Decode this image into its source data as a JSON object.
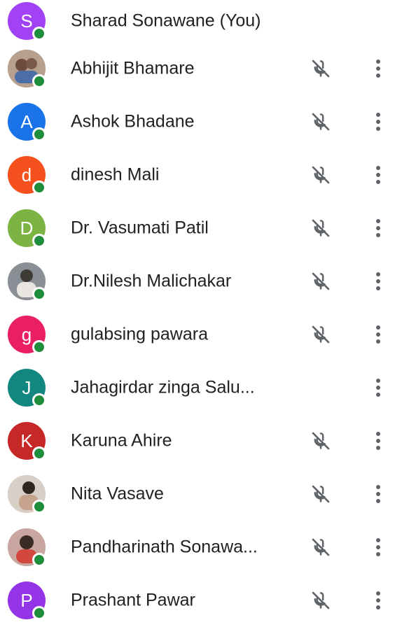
{
  "colors": {
    "online": "#1e8e3e",
    "text": "#202124",
    "icon": "#5f6368"
  },
  "participants": [
    {
      "name": "Sharad Sonawane (You)",
      "initial": "S",
      "avatar_color": "#a142f4",
      "photo": false,
      "muted_icon": false,
      "more_icon": false
    },
    {
      "name": "Abhijit Bhamare",
      "initial": "",
      "avatar_color": "#b7a08d",
      "photo": true,
      "muted_icon": true,
      "more_icon": true
    },
    {
      "name": "Ashok Bhadane",
      "initial": "A",
      "avatar_color": "#1a73e8",
      "photo": false,
      "muted_icon": true,
      "more_icon": true
    },
    {
      "name": "dinesh Mali",
      "initial": "d",
      "avatar_color": "#f4511e",
      "photo": false,
      "muted_icon": true,
      "more_icon": true
    },
    {
      "name": "Dr. Vasumati Patil",
      "initial": "D",
      "avatar_color": "#7cb342",
      "photo": false,
      "muted_icon": true,
      "more_icon": true
    },
    {
      "name": "Dr.Nilesh Malichakar",
      "initial": "",
      "avatar_color": "#8a8f96",
      "photo": true,
      "muted_icon": true,
      "more_icon": true
    },
    {
      "name": "gulabsing pawara",
      "initial": "g",
      "avatar_color": "#e91e63",
      "photo": false,
      "muted_icon": true,
      "more_icon": true
    },
    {
      "name": "Jahagirdar zinga Salu...",
      "initial": "J",
      "avatar_color": "#12877f",
      "photo": false,
      "muted_icon": false,
      "more_icon": true
    },
    {
      "name": "Karuna Ahire",
      "initial": "K",
      "avatar_color": "#c62828",
      "photo": false,
      "muted_icon": true,
      "more_icon": true
    },
    {
      "name": "Nita Vasave",
      "initial": "",
      "avatar_color": "#d8cfc7",
      "photo": true,
      "muted_icon": true,
      "more_icon": true
    },
    {
      "name": "Pandharinath Sonawa...",
      "initial": "",
      "avatar_color": "#c9a7a0",
      "photo": true,
      "muted_icon": true,
      "more_icon": true
    },
    {
      "name": "Prashant Pawar",
      "initial": "P",
      "avatar_color": "#9334e6",
      "photo": false,
      "muted_icon": true,
      "more_icon": true
    }
  ]
}
